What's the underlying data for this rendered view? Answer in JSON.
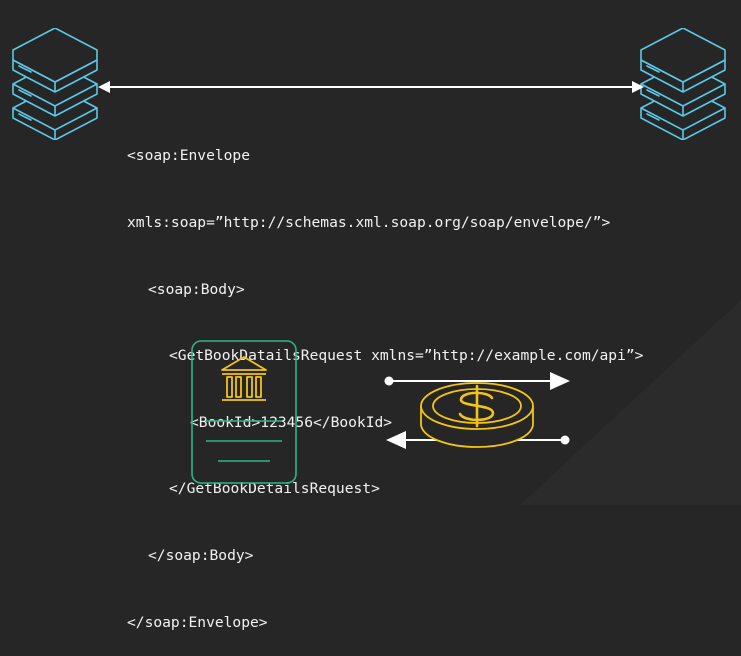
{
  "code": {
    "lines": [
      "<soap:Envelope",
      "xmls:soap=”http://schemas.xml.soap.org/soap/envelope/”>",
      "<soap:Body>",
      "<GetBookDatailsRequest xmlns=”http://example.com/api”>",
      "<BookId>123456</BookId>",
      "</GetBookDetailsRequest>",
      "</soap:Body>",
      "</soap:Envelope>"
    ]
  },
  "colors": {
    "background": "#262626",
    "server_stroke": "#5bc8e6",
    "arrow": "#ffffff",
    "document_stroke": "#2bb58a",
    "bank_icon": "#f2c418",
    "coin_stroke": "#f2c418"
  },
  "icons": {
    "left_server": "server-stack-icon",
    "right_server": "server-stack-icon",
    "bank": "bank-building-icon",
    "coin": "dollar-coin-icon"
  }
}
